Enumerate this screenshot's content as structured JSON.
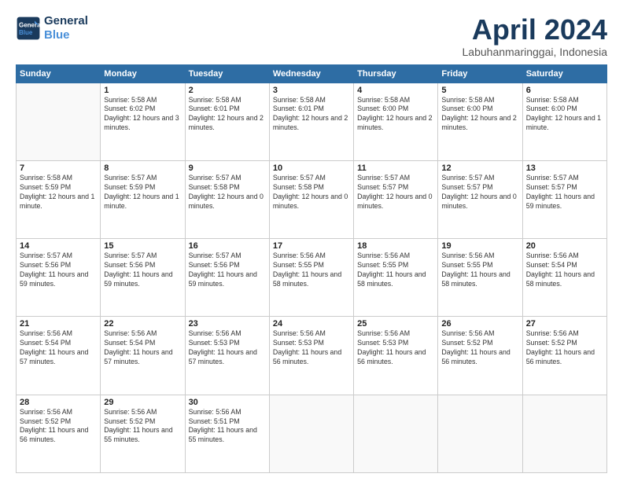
{
  "logo": {
    "line1": "General",
    "line2": "Blue"
  },
  "title": "April 2024",
  "location": "Labuhanmaringgai, Indonesia",
  "weekdays": [
    "Sunday",
    "Monday",
    "Tuesday",
    "Wednesday",
    "Thursday",
    "Friday",
    "Saturday"
  ],
  "weeks": [
    [
      {
        "day": "",
        "sunrise": "",
        "sunset": "",
        "daylight": ""
      },
      {
        "day": "1",
        "sunrise": "Sunrise: 5:58 AM",
        "sunset": "Sunset: 6:02 PM",
        "daylight": "Daylight: 12 hours and 3 minutes."
      },
      {
        "day": "2",
        "sunrise": "Sunrise: 5:58 AM",
        "sunset": "Sunset: 6:01 PM",
        "daylight": "Daylight: 12 hours and 2 minutes."
      },
      {
        "day": "3",
        "sunrise": "Sunrise: 5:58 AM",
        "sunset": "Sunset: 6:01 PM",
        "daylight": "Daylight: 12 hours and 2 minutes."
      },
      {
        "day": "4",
        "sunrise": "Sunrise: 5:58 AM",
        "sunset": "Sunset: 6:00 PM",
        "daylight": "Daylight: 12 hours and 2 minutes."
      },
      {
        "day": "5",
        "sunrise": "Sunrise: 5:58 AM",
        "sunset": "Sunset: 6:00 PM",
        "daylight": "Daylight: 12 hours and 2 minutes."
      },
      {
        "day": "6",
        "sunrise": "Sunrise: 5:58 AM",
        "sunset": "Sunset: 6:00 PM",
        "daylight": "Daylight: 12 hours and 1 minute."
      }
    ],
    [
      {
        "day": "7",
        "sunrise": "Sunrise: 5:58 AM",
        "sunset": "Sunset: 5:59 PM",
        "daylight": "Daylight: 12 hours and 1 minute."
      },
      {
        "day": "8",
        "sunrise": "Sunrise: 5:57 AM",
        "sunset": "Sunset: 5:59 PM",
        "daylight": "Daylight: 12 hours and 1 minute."
      },
      {
        "day": "9",
        "sunrise": "Sunrise: 5:57 AM",
        "sunset": "Sunset: 5:58 PM",
        "daylight": "Daylight: 12 hours and 0 minutes."
      },
      {
        "day": "10",
        "sunrise": "Sunrise: 5:57 AM",
        "sunset": "Sunset: 5:58 PM",
        "daylight": "Daylight: 12 hours and 0 minutes."
      },
      {
        "day": "11",
        "sunrise": "Sunrise: 5:57 AM",
        "sunset": "Sunset: 5:57 PM",
        "daylight": "Daylight: 12 hours and 0 minutes."
      },
      {
        "day": "12",
        "sunrise": "Sunrise: 5:57 AM",
        "sunset": "Sunset: 5:57 PM",
        "daylight": "Daylight: 12 hours and 0 minutes."
      },
      {
        "day": "13",
        "sunrise": "Sunrise: 5:57 AM",
        "sunset": "Sunset: 5:57 PM",
        "daylight": "Daylight: 11 hours and 59 minutes."
      }
    ],
    [
      {
        "day": "14",
        "sunrise": "Sunrise: 5:57 AM",
        "sunset": "Sunset: 5:56 PM",
        "daylight": "Daylight: 11 hours and 59 minutes."
      },
      {
        "day": "15",
        "sunrise": "Sunrise: 5:57 AM",
        "sunset": "Sunset: 5:56 PM",
        "daylight": "Daylight: 11 hours and 59 minutes."
      },
      {
        "day": "16",
        "sunrise": "Sunrise: 5:57 AM",
        "sunset": "Sunset: 5:56 PM",
        "daylight": "Daylight: 11 hours and 59 minutes."
      },
      {
        "day": "17",
        "sunrise": "Sunrise: 5:56 AM",
        "sunset": "Sunset: 5:55 PM",
        "daylight": "Daylight: 11 hours and 58 minutes."
      },
      {
        "day": "18",
        "sunrise": "Sunrise: 5:56 AM",
        "sunset": "Sunset: 5:55 PM",
        "daylight": "Daylight: 11 hours and 58 minutes."
      },
      {
        "day": "19",
        "sunrise": "Sunrise: 5:56 AM",
        "sunset": "Sunset: 5:55 PM",
        "daylight": "Daylight: 11 hours and 58 minutes."
      },
      {
        "day": "20",
        "sunrise": "Sunrise: 5:56 AM",
        "sunset": "Sunset: 5:54 PM",
        "daylight": "Daylight: 11 hours and 58 minutes."
      }
    ],
    [
      {
        "day": "21",
        "sunrise": "Sunrise: 5:56 AM",
        "sunset": "Sunset: 5:54 PM",
        "daylight": "Daylight: 11 hours and 57 minutes."
      },
      {
        "day": "22",
        "sunrise": "Sunrise: 5:56 AM",
        "sunset": "Sunset: 5:54 PM",
        "daylight": "Daylight: 11 hours and 57 minutes."
      },
      {
        "day": "23",
        "sunrise": "Sunrise: 5:56 AM",
        "sunset": "Sunset: 5:53 PM",
        "daylight": "Daylight: 11 hours and 57 minutes."
      },
      {
        "day": "24",
        "sunrise": "Sunrise: 5:56 AM",
        "sunset": "Sunset: 5:53 PM",
        "daylight": "Daylight: 11 hours and 56 minutes."
      },
      {
        "day": "25",
        "sunrise": "Sunrise: 5:56 AM",
        "sunset": "Sunset: 5:53 PM",
        "daylight": "Daylight: 11 hours and 56 minutes."
      },
      {
        "day": "26",
        "sunrise": "Sunrise: 5:56 AM",
        "sunset": "Sunset: 5:52 PM",
        "daylight": "Daylight: 11 hours and 56 minutes."
      },
      {
        "day": "27",
        "sunrise": "Sunrise: 5:56 AM",
        "sunset": "Sunset: 5:52 PM",
        "daylight": "Daylight: 11 hours and 56 minutes."
      }
    ],
    [
      {
        "day": "28",
        "sunrise": "Sunrise: 5:56 AM",
        "sunset": "Sunset: 5:52 PM",
        "daylight": "Daylight: 11 hours and 56 minutes."
      },
      {
        "day": "29",
        "sunrise": "Sunrise: 5:56 AM",
        "sunset": "Sunset: 5:52 PM",
        "daylight": "Daylight: 11 hours and 55 minutes."
      },
      {
        "day": "30",
        "sunrise": "Sunrise: 5:56 AM",
        "sunset": "Sunset: 5:51 PM",
        "daylight": "Daylight: 11 hours and 55 minutes."
      },
      {
        "day": "",
        "sunrise": "",
        "sunset": "",
        "daylight": ""
      },
      {
        "day": "",
        "sunrise": "",
        "sunset": "",
        "daylight": ""
      },
      {
        "day": "",
        "sunrise": "",
        "sunset": "",
        "daylight": ""
      },
      {
        "day": "",
        "sunrise": "",
        "sunset": "",
        "daylight": ""
      }
    ]
  ]
}
